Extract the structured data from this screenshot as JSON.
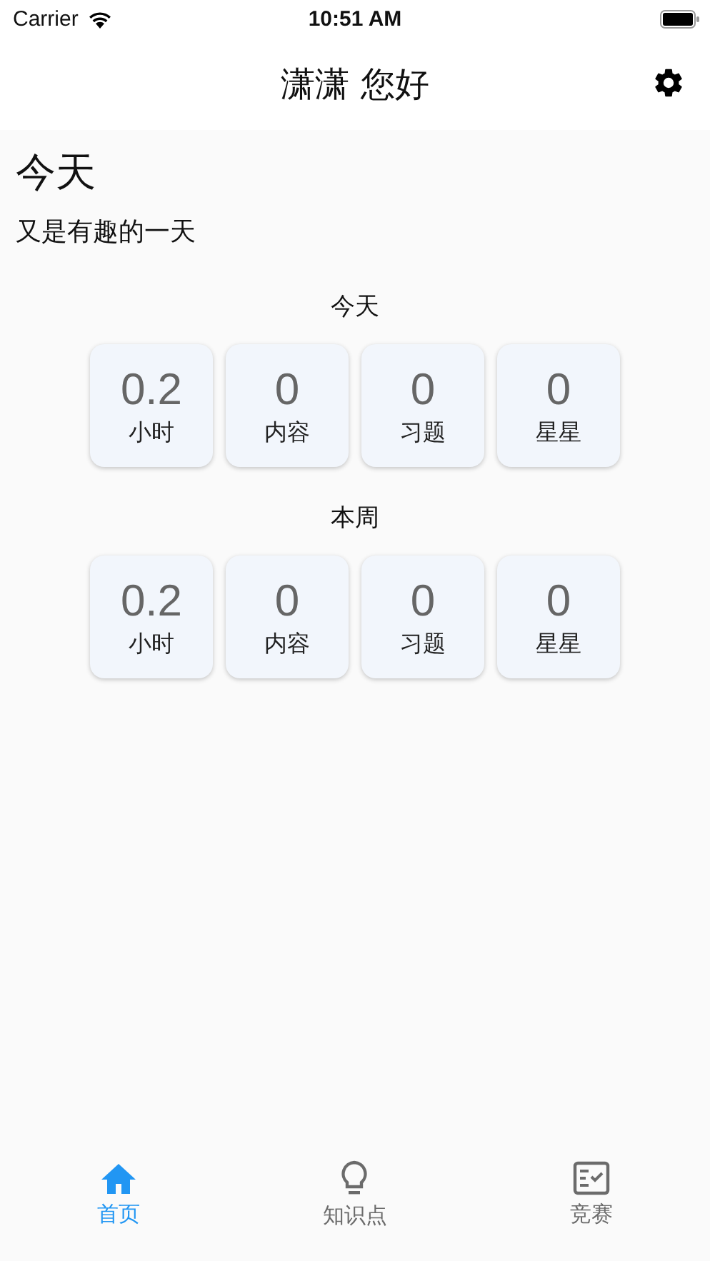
{
  "status_bar": {
    "carrier": "Carrier",
    "time": "10:51 AM"
  },
  "header": {
    "title": "潇潇 您好"
  },
  "page": {
    "title": "今天",
    "subtitle": "又是有趣的一天"
  },
  "sections": [
    {
      "title": "今天",
      "stats": [
        {
          "value": "0.2",
          "label": "小时"
        },
        {
          "value": "0",
          "label": "内容"
        },
        {
          "value": "0",
          "label": "习题"
        },
        {
          "value": "0",
          "label": "星星"
        }
      ]
    },
    {
      "title": "本周",
      "stats": [
        {
          "value": "0.2",
          "label": "小时"
        },
        {
          "value": "0",
          "label": "内容"
        },
        {
          "value": "0",
          "label": "习题"
        },
        {
          "value": "0",
          "label": "星星"
        }
      ]
    }
  ],
  "tab_bar": [
    {
      "kind": "home",
      "label": "首页",
      "selected": true
    },
    {
      "kind": "bulb",
      "label": "知识点",
      "selected": false
    },
    {
      "kind": "contest",
      "label": "竞赛",
      "selected": false
    }
  ]
}
